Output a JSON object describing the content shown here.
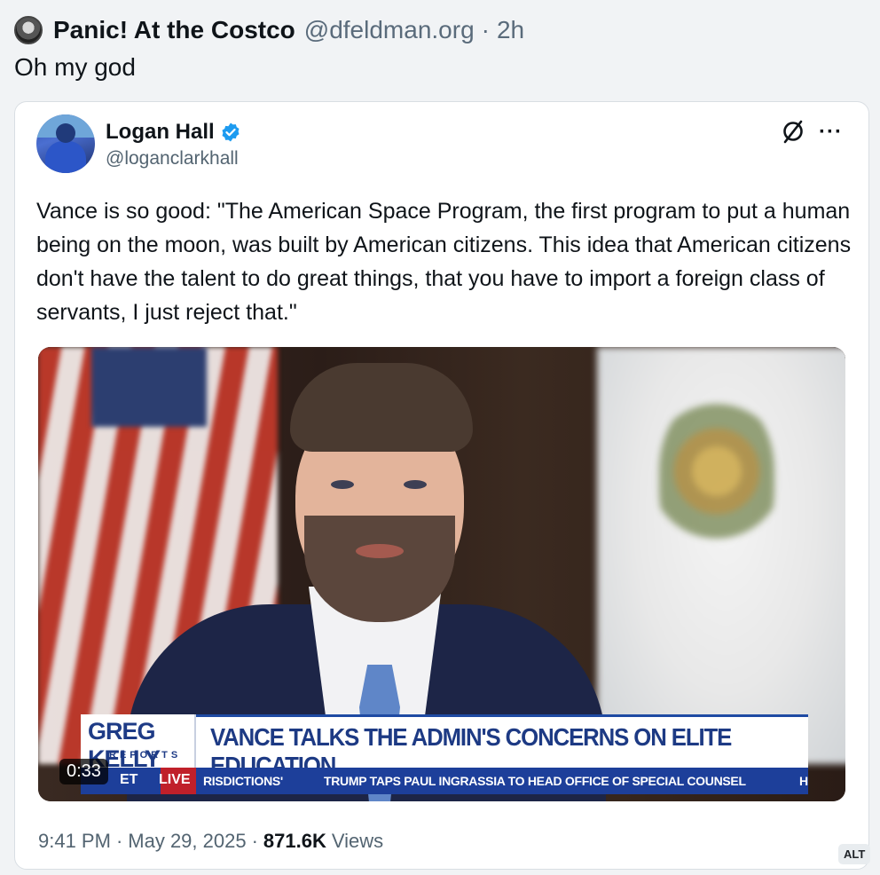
{
  "post": {
    "author_name": "Panic! At the Costco",
    "author_handle": "@dfeldman.org",
    "separator": "·",
    "time": "2h",
    "text": "Oh my god"
  },
  "embed": {
    "author_name": "Logan Hall",
    "author_handle": "@loganclarkhall",
    "more_label": "···",
    "text": "Vance is so good: \"The American Space Program, the first program to put a human being on the moon, was built by American citizens. This idea that American citizens don't have the talent to do great things, that you have to import a foreign class of servants, I just reject that.\"",
    "video": {
      "duration": "0:33",
      "chyron_logo": "GREG KELLY",
      "chyron_logo_sub": "REPORTS",
      "headline": "VANCE TALKS THE ADMIN'S CONCERNS ON ELITE EDUCATION",
      "ticker_et": "ET",
      "ticker_live": "LIVE",
      "ticker_left": "RISDICTIONS'",
      "ticker_story": "TRUMP TAPS PAUL INGRASSIA TO HEAD OFFICE OF SPECIAL COUNSEL",
      "ticker_end": "H"
    },
    "footer": {
      "time": "9:41 PM",
      "date": "May 29, 2025",
      "views_count": "871.6K",
      "views_label": "Views",
      "dot": "·"
    },
    "alt_label": "ALT"
  },
  "colors": {
    "verified": "#1d9bf0",
    "chyron_blue": "#1d3a84",
    "live_red": "#c0202a"
  }
}
